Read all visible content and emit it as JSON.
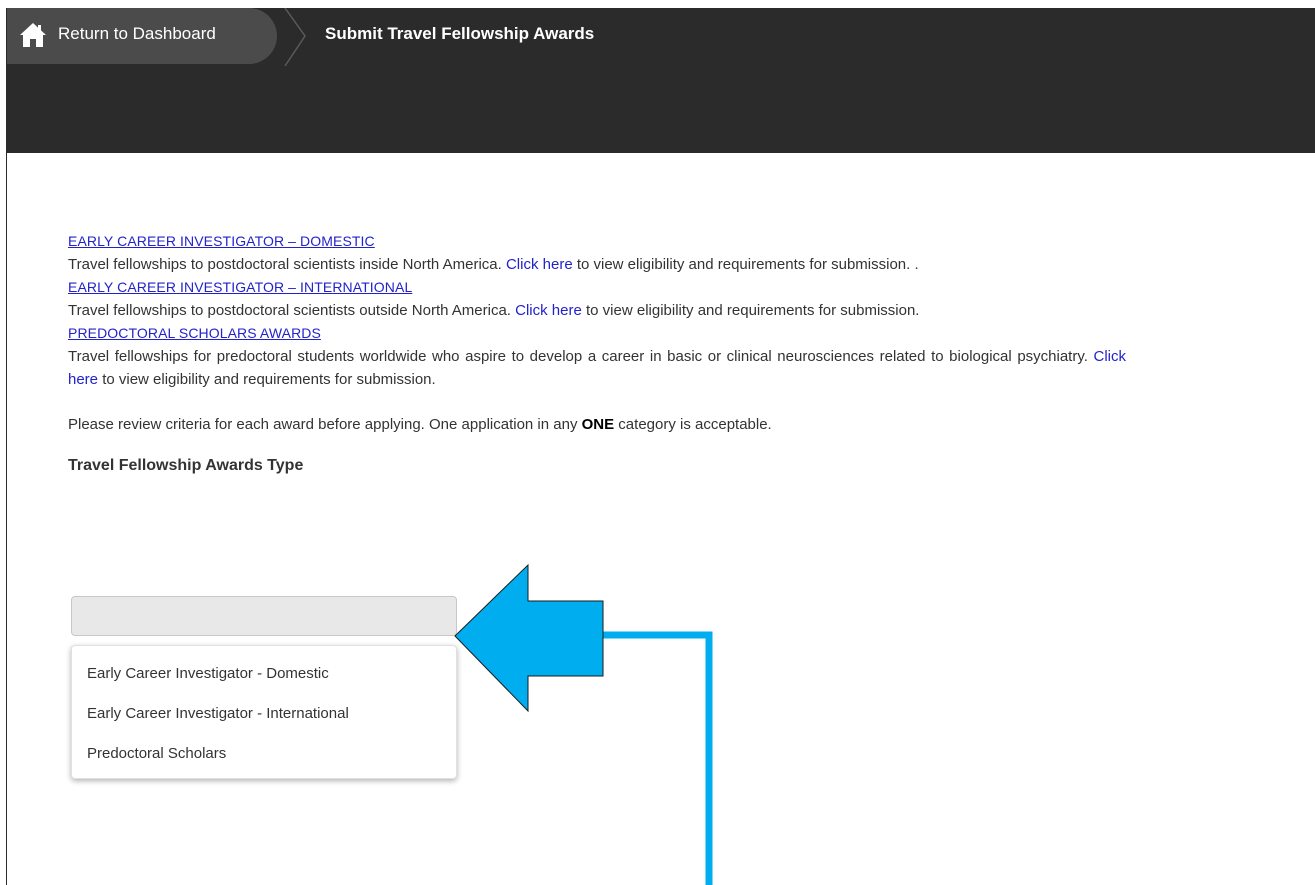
{
  "header": {
    "home_label": "Return to Dashboard",
    "page_title": "Submit Travel Fellowship Awards"
  },
  "sections": [
    {
      "link": "EARLY CAREER INVESTIGATOR – DOMESTIC",
      "desc_before": "Travel fellowships to postdoctoral scientists inside North America. ",
      "click_here": "Click here",
      "desc_after": " to view eligibility and requirements for submission. ."
    },
    {
      "link": "EARLY CAREER INVESTIGATOR – INTERNATIONAL",
      "desc_before": "Travel fellowships to postdoctoral scientists outside North America. ",
      "click_here": "Click here",
      "desc_after": " to view eligibility and requirements for submission."
    },
    {
      "link": "PREDOCTORAL SCHOLARS AWARDS",
      "desc_before": "Travel fellowships for predoctoral students worldwide who aspire to develop a career in basic or clinical neurosciences related to biological psychiatry. ",
      "click_here": "Click here",
      "desc_after": " to view eligibility and requirements for submission."
    }
  ],
  "notice": {
    "before": "Please review criteria for each award before applying. One application in any ",
    "emphasis": "ONE",
    "after": " category is acceptable."
  },
  "award_type": {
    "label": "Travel Fellowship Awards Type",
    "selected_value": "",
    "options": [
      "Early Career Investigator - Domestic",
      "Early Career Investigator - International",
      "Predoctoral Scholars"
    ]
  },
  "colors": {
    "header_bg": "#2b2b2b",
    "crumb_bg": "#4b4b4b",
    "link": "#2222cc",
    "annotation_arrow": "#00aeef"
  },
  "icons": {
    "home": "home-icon",
    "separator": "breadcrumb-chevron"
  }
}
